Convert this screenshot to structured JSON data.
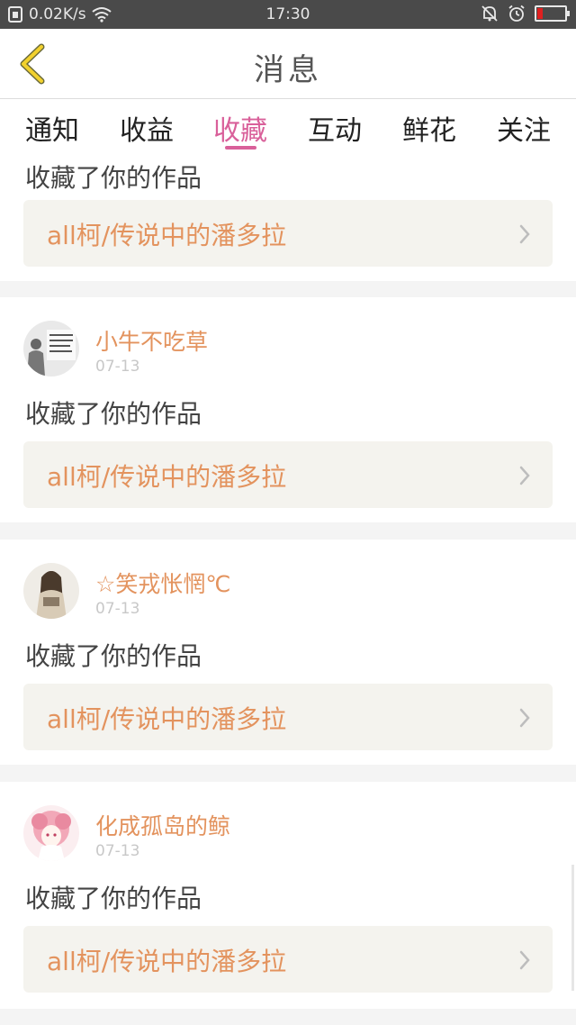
{
  "status_bar": {
    "speed": "0.02K/s",
    "time": "17:30",
    "battery_level": 0.2,
    "icons": [
      "sim-icon",
      "wifi-icon",
      "bell-off-icon",
      "alarm-icon",
      "battery-icon"
    ]
  },
  "header": {
    "title": "消息",
    "back_icon": "chevron-left-icon"
  },
  "tabs": [
    {
      "label": "通知"
    },
    {
      "label": "收益"
    },
    {
      "label": "收藏",
      "active": true
    },
    {
      "label": "互动"
    },
    {
      "label": "鲜花"
    },
    {
      "label": "关注"
    }
  ],
  "messages": [
    {
      "action": "收藏了你的作品",
      "work": "all柯/传说中的潘多拉"
    },
    {
      "user": "小牛不吃草",
      "date": "07-13",
      "action": "收藏了你的作品",
      "work": "all柯/传说中的潘多拉"
    },
    {
      "user": "☆笑戎怅惘℃",
      "date": "07-13",
      "action": "收藏了你的作品",
      "work": "all柯/传说中的潘多拉"
    },
    {
      "user": "化成孤岛的鲸",
      "date": "07-13",
      "action": "收藏了你的作品",
      "work": "all柯/传说中的潘多拉"
    }
  ],
  "colors": {
    "accent": "#d9609a",
    "username": "#e3935e",
    "work_title": "#e3935e",
    "status_bar": "#4a4a4a",
    "work_box": "#f4f3ee"
  }
}
